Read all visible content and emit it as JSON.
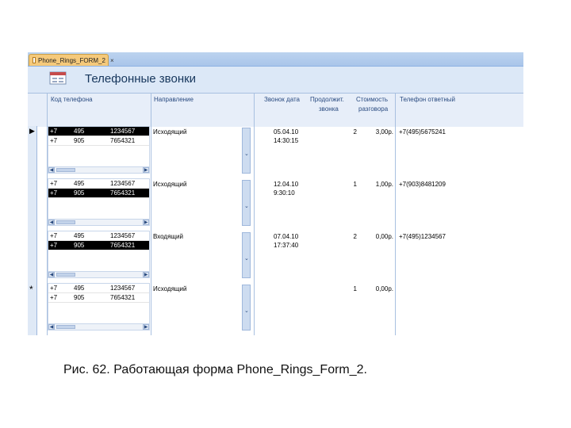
{
  "tab": {
    "label": "Phone_Rings_FORM_2",
    "close": "×"
  },
  "form": {
    "title": "Телефонные звонки"
  },
  "columns": {
    "code": "Код телефона",
    "direction": "Направление",
    "date": "Звонок дата",
    "duration_l1": "Продолжит.",
    "duration_l2": "звонка",
    "cost_l1": "Стоимость",
    "cost_l2": "разговора",
    "answer_phone": "Телефон ответный"
  },
  "markers": {
    "current": "▶",
    "new": "*"
  },
  "records": [
    {
      "phones": [
        {
          "country": "+7",
          "area": "495",
          "number": "1234567"
        },
        {
          "country": "+7",
          "area": "905",
          "number": "7654321"
        }
      ],
      "direction": "Исходящий",
      "date": "05.04.10",
      "time": "14:30:15",
      "duration": "2",
      "cost": "3,00р.",
      "answer_phone": "+7(495)5675241"
    },
    {
      "phones": [
        {
          "country": "+7",
          "area": "495",
          "number": "1234567"
        },
        {
          "country": "+7",
          "area": "905",
          "number": "7654321"
        }
      ],
      "direction": "Исходящий",
      "date": "12.04.10",
      "time": "9:30:10",
      "duration": "1",
      "cost": "1,00р.",
      "answer_phone": "+7(903)8481209"
    },
    {
      "phones": [
        {
          "country": "+7",
          "area": "495",
          "number": "1234567"
        },
        {
          "country": "+7",
          "area": "905",
          "number": "7654321"
        }
      ],
      "direction": "Входящий",
      "date": "07.04.10",
      "time": "17:37:40",
      "duration": "2",
      "cost": "0,00р.",
      "answer_phone": "+7(495)1234567"
    },
    {
      "phones": [
        {
          "country": "+7",
          "area": "495",
          "number": "1234567"
        },
        {
          "country": "+7",
          "area": "905",
          "number": "7654321"
        }
      ],
      "direction": "Исходящий",
      "date": "",
      "time": "",
      "duration": "1",
      "cost": "0,00р.",
      "answer_phone": ""
    }
  ],
  "scroll": {
    "left": "◀",
    "right": "▶",
    "down": "⌄"
  },
  "caption": "Рис. 62. Работающая форма Phone_Rings_Form_2."
}
